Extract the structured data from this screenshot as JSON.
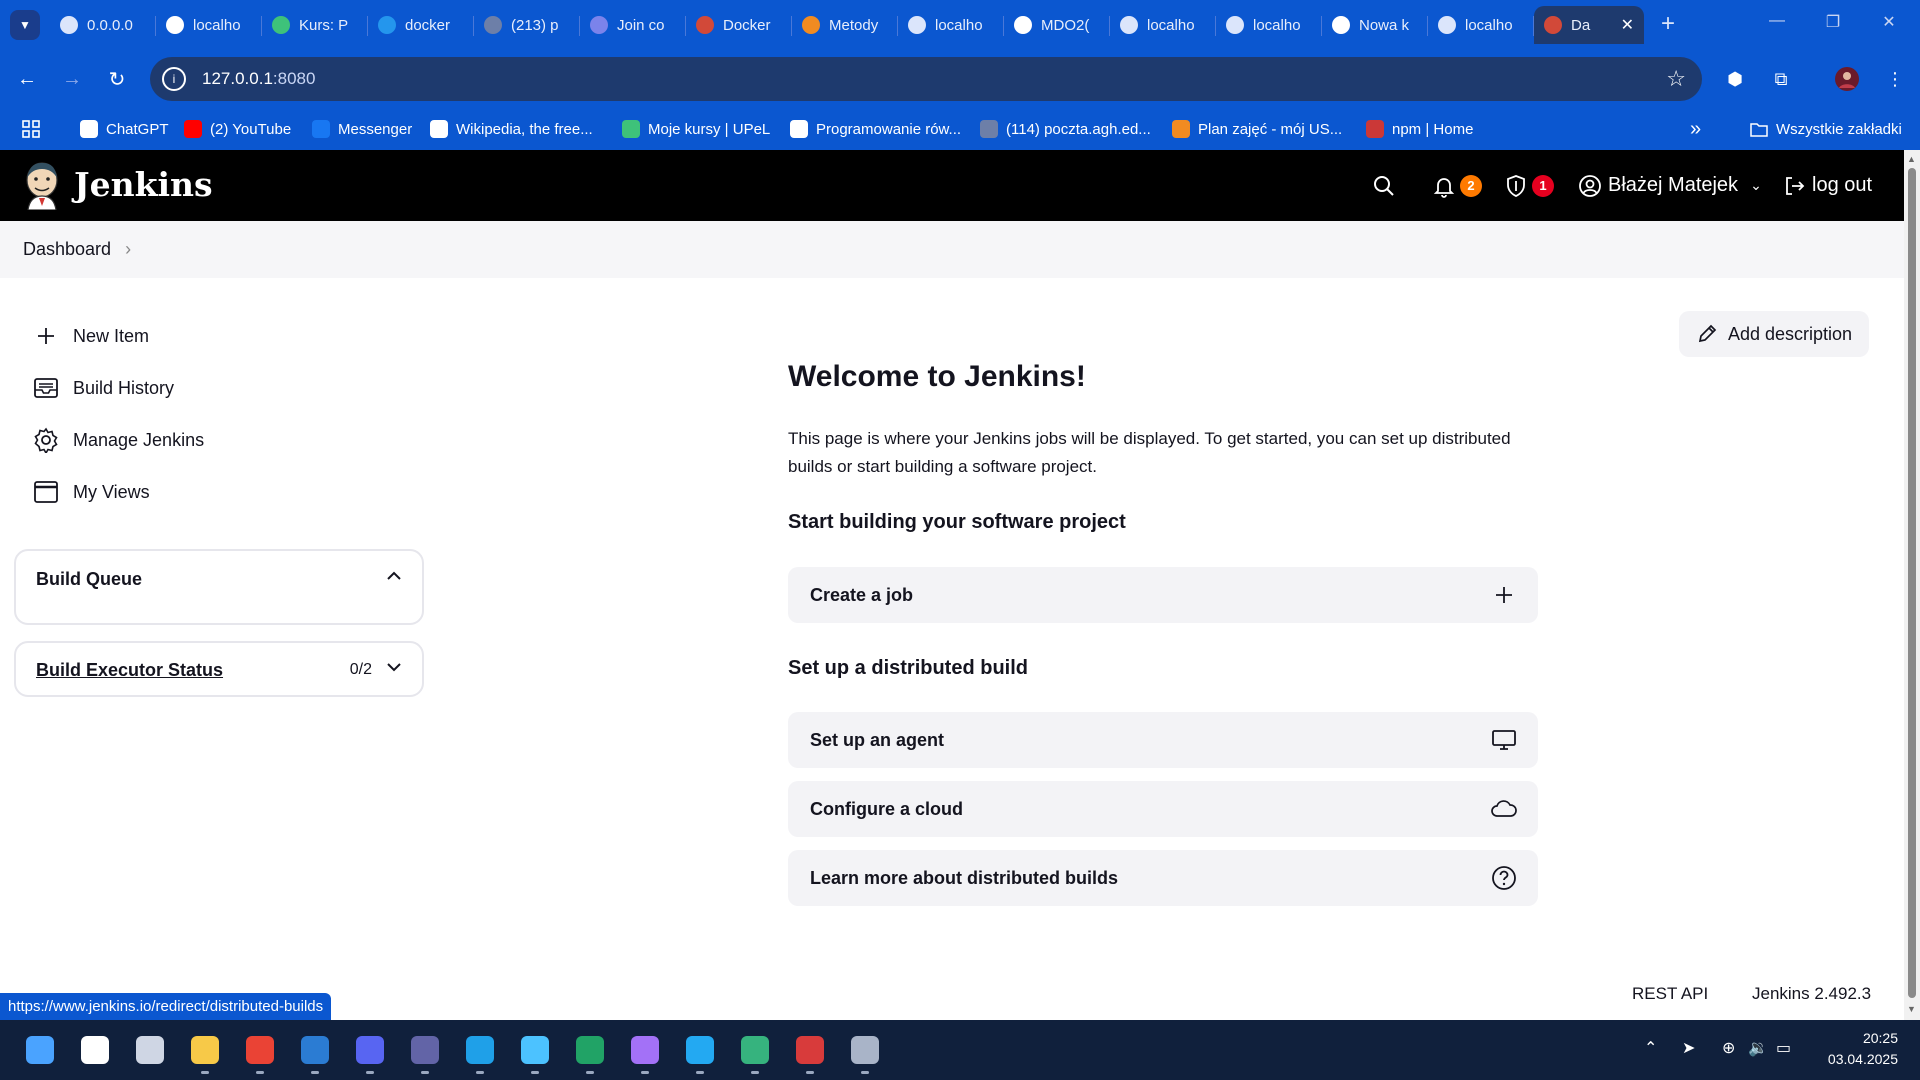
{
  "browser": {
    "tabs": [
      {
        "title": "0.0.0.0",
        "icon": "globe-icon",
        "color": "#dbe5fb"
      },
      {
        "title": "localho",
        "icon": "google-icon",
        "color": "#ffffff"
      },
      {
        "title": "Kurs: P",
        "icon": "upel-icon",
        "color": "#3ec27a"
      },
      {
        "title": "docker",
        "icon": "docker-icon",
        "color": "#2496ed"
      },
      {
        "title": "(213) p",
        "icon": "list-icon",
        "color": "#6d7fa8"
      },
      {
        "title": "Join co",
        "icon": "teams-icon",
        "color": "#7b83eb"
      },
      {
        "title": "Docker",
        "icon": "jenkins-icon",
        "color": "#d24939"
      },
      {
        "title": "Metody",
        "icon": "u-icon",
        "color": "#f18b21"
      },
      {
        "title": "localho",
        "icon": "globe-icon",
        "color": "#dbe5fb"
      },
      {
        "title": "MDO2(",
        "icon": "github-icon",
        "color": "#ffffff"
      },
      {
        "title": "localho",
        "icon": "globe-icon",
        "color": "#dbe5fb"
      },
      {
        "title": "localho",
        "icon": "globe-icon",
        "color": "#dbe5fb"
      },
      {
        "title": "Nowa k",
        "icon": "chrome-icon",
        "color": "#ffffff"
      },
      {
        "title": "localho",
        "icon": "globe-icon",
        "color": "#dbe5fb"
      },
      {
        "title": "Da",
        "icon": "jenkins-icon",
        "color": "#d24939",
        "active": true
      }
    ],
    "url_host": "127.0.0.1",
    "url_port": ":8080",
    "bookmarks": [
      {
        "label": "ChatGPT",
        "icon": "chatgpt-icon",
        "color": "#ffffff"
      },
      {
        "label": "(2) YouTube",
        "icon": "youtube-icon",
        "color": "#ff0000"
      },
      {
        "label": "Messenger",
        "icon": "messenger-icon",
        "color": "#1877f2"
      },
      {
        "label": "Wikipedia, the free...",
        "icon": "wikipedia-icon",
        "color": "#ffffff"
      },
      {
        "label": "Moje kursy | UPeL",
        "icon": "upel-icon",
        "color": "#3ec27a"
      },
      {
        "label": "Programowanie rów...",
        "icon": "globe-icon",
        "color": "#ffffff"
      },
      {
        "label": "(114) poczta.agh.ed...",
        "icon": "list-icon",
        "color": "#6d7fa8"
      },
      {
        "label": "Plan zajęć - mój US...",
        "icon": "u-icon",
        "color": "#f18b21"
      },
      {
        "label": "npm | Home",
        "icon": "npm-icon",
        "color": "#cb3837"
      }
    ],
    "more_bookmarks": "»",
    "all_bookmarks": "Wszystkie zakładki",
    "status_url": "https://www.jenkins.io/redirect/distributed-builds"
  },
  "header": {
    "app_title": "Jenkins",
    "notifications_count": "2",
    "security_count": "1",
    "user_name": "Błażej Matejek",
    "logout_label": "log out",
    "colors": {
      "notification_badge": "#ff7a00",
      "security_badge": "#e6001f"
    }
  },
  "breadcrumb": {
    "root": "Dashboard"
  },
  "sidebar": {
    "tasks": [
      {
        "label": "New Item",
        "icon": "plus-icon"
      },
      {
        "label": "Build History",
        "icon": "inbox-icon"
      },
      {
        "label": "Manage Jenkins",
        "icon": "gear-icon"
      },
      {
        "label": "My Views",
        "icon": "window-icon"
      }
    ],
    "build_queue_title": "Build Queue",
    "executor_title": "Build Executor Status",
    "executor_count": "0/2"
  },
  "main": {
    "add_description": "Add description",
    "welcome_title": "Welcome to Jenkins!",
    "intro_text": "This page is where your Jenkins jobs will be displayed. To get started, you can set up distributed builds or start building a software project.",
    "start_heading": "Start building your software project",
    "create_job": "Create a job",
    "distributed_heading": "Set up a distributed build",
    "setup_agent": "Set up an agent",
    "configure_cloud": "Configure a cloud",
    "learn_more": "Learn more about distributed builds"
  },
  "footer": {
    "rest_api": "REST API",
    "version": "Jenkins 2.492.3"
  },
  "taskbar": {
    "apps": [
      "start-icon",
      "search-icon",
      "task-view-icon",
      "file-explorer-icon",
      "chrome-icon",
      "word-icon",
      "discord-icon",
      "teams-icon",
      "edge-icon",
      "notepad-icon",
      "excel-icon",
      "visual-studio-icon",
      "vscode-icon",
      "vmware-icon",
      "calculator-icon",
      "settings-icon"
    ],
    "time": "20:25",
    "date": "03.04.2025"
  }
}
